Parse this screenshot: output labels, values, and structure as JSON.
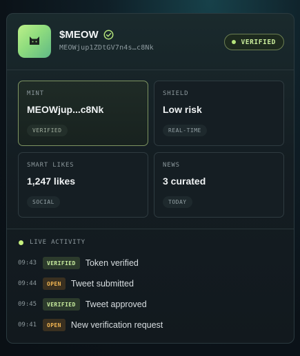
{
  "header": {
    "token_name": "$MEOW",
    "token_address": "MEOWjup1ZDtGV7n4s…c8Nk",
    "status_badge": "VERIFIED"
  },
  "tiles": [
    {
      "label": "MINT",
      "value": "MEOWjup...c8Nk",
      "tag": "VERIFIED"
    },
    {
      "label": "SHIELD",
      "value": "Low risk",
      "tag": "REAL-TIME"
    },
    {
      "label": "SMART LIKES",
      "value": "1,247 likes",
      "tag": "SOCIAL"
    },
    {
      "label": "NEWS",
      "value": "3 curated",
      "tag": "TODAY"
    }
  ],
  "activity": {
    "title": "LIVE ACTIVITY",
    "items": [
      {
        "time": "09:43",
        "badge": "VERIFIED",
        "text": "Token verified"
      },
      {
        "time": "09:44",
        "badge": "OPEN",
        "text": "Tweet submitted"
      },
      {
        "time": "09:45",
        "badge": "VERIFIED",
        "text": "Tweet approved"
      },
      {
        "time": "09:41",
        "badge": "OPEN",
        "text": "New verification request"
      }
    ]
  },
  "colors": {
    "accent_green": "#c6f07e",
    "open_orange": "#f1b552",
    "card_bg": "#141d22"
  }
}
